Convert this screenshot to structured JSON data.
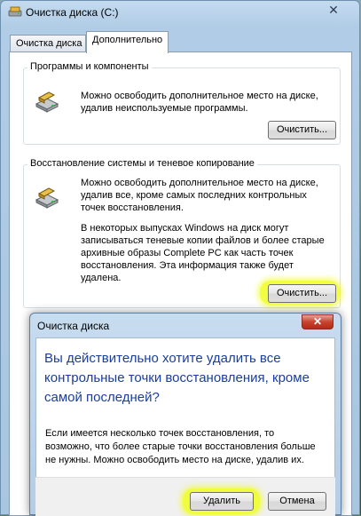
{
  "window": {
    "title": "Очистка диска  (C:)",
    "close_glyph": "✕"
  },
  "tabs": [
    {
      "label": "Очистка диска",
      "active": false
    },
    {
      "label": "Дополнительно",
      "active": true
    }
  ],
  "programs": {
    "group_title": "Программы и компоненты",
    "description": "Можно освободить дополнительное место на диске, удалив неиспользуемые программы.",
    "button_label": "Очистить..."
  },
  "restore": {
    "group_title": "Восстановление системы и теневое копирование",
    "description": "Можно освободить дополнительное место на диске, удалив все, кроме самых последних контрольных точек восстановления.",
    "note": "В некоторых выпусках Windows на диск могут записываться теневые копии файлов и более старые архивные образы Complete PC как часть точек восстановления. Эта информация также будет удалена.",
    "button_label": "Очистить..."
  },
  "dialog": {
    "title": "Очистка диска",
    "close_glyph": "✕",
    "heading": "Вы действительно хотите удалить все контрольные точки восстановления, кроме самой последней?",
    "body": "Если имеется несколько точек восстановления, то возможно, что более старые точки восстановления больше не нужны. Можно освободить место на диске, удалив их.",
    "delete_label": "Удалить",
    "cancel_label": "Отмена"
  },
  "icons": {
    "title": "disk-cleanup-icon",
    "programs": "drive-cleanup-icon",
    "restore": "drive-cleanup-icon"
  },
  "colors": {
    "highlight": "#f0ff1e",
    "heading_blue": "#1a3e9a"
  }
}
